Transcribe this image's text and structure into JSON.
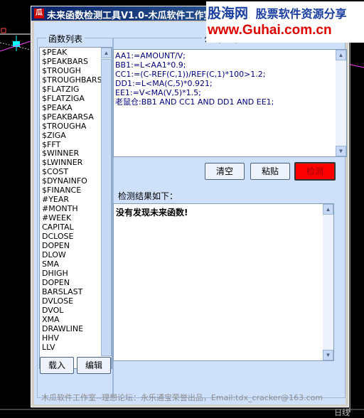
{
  "window": {
    "title": "未来函数检测工具V1.0-木瓜软件工作室"
  },
  "function_list": {
    "label": "函数列表",
    "items": [
      "$PEAK",
      "$PEAKBARS",
      "$TROUGH",
      "$TROUGHBARS",
      "$FLATZIG",
      "$FLATZIGA",
      "$PEAKA",
      "$PEAKBARSA",
      "$TROUGHA",
      "$ZIGA",
      "$FFT",
      "$WINNER",
      "$LWINNER",
      "$COST",
      "$DYNAINFO",
      "$FINANCE",
      "#YEAR",
      "#MONTH",
      "#WEEK",
      "CAPITAL",
      "DCLOSE",
      "DOPEN",
      "DLOW",
      "SMA",
      "DHIGH",
      "DOPEN",
      "BARSLAST",
      "DVLOSE",
      "DVOL",
      "XMA",
      "DRAWLINE",
      "HHV",
      "LLV"
    ],
    "load_button": "载入",
    "edit_button": "编辑"
  },
  "formula": {
    "label": "公式代码",
    "lines": [
      "AA1:=AMOUNT/V;",
      "BB1:=L<AA1*0.9;",
      "CC1:=(C-REF(C,1))/REF(C,1)*100>1.2;",
      "DD1:=L<MA(C,5)*0.921;",
      "EE1:=V<MA(V,5)*1.5;",
      "老鼠仓:BB1 AND CC1 AND DD1 AND EE1;"
    ]
  },
  "buttons": {
    "clear": "清空",
    "paste": "粘贴",
    "detect": "检测"
  },
  "result": {
    "label": "检测结果如下：",
    "text": "没有发现未来函数!"
  },
  "footer": {
    "text": "木瓜软件工作室--理想论坛：永乐通宝荣誉出品，Email:tdx_cracker@163.com"
  },
  "watermark": {
    "line1_brand": "股海网",
    "line1_tagline": "股票软件资源分享",
    "line2": "www.Guhai.com.cn"
  },
  "background": {
    "corner_text": "日线"
  },
  "colors": {
    "titlebar": "#0a246a",
    "client_bg": "#cfe0fb",
    "detect_button": "#ff0000",
    "code_text": "#000080"
  }
}
